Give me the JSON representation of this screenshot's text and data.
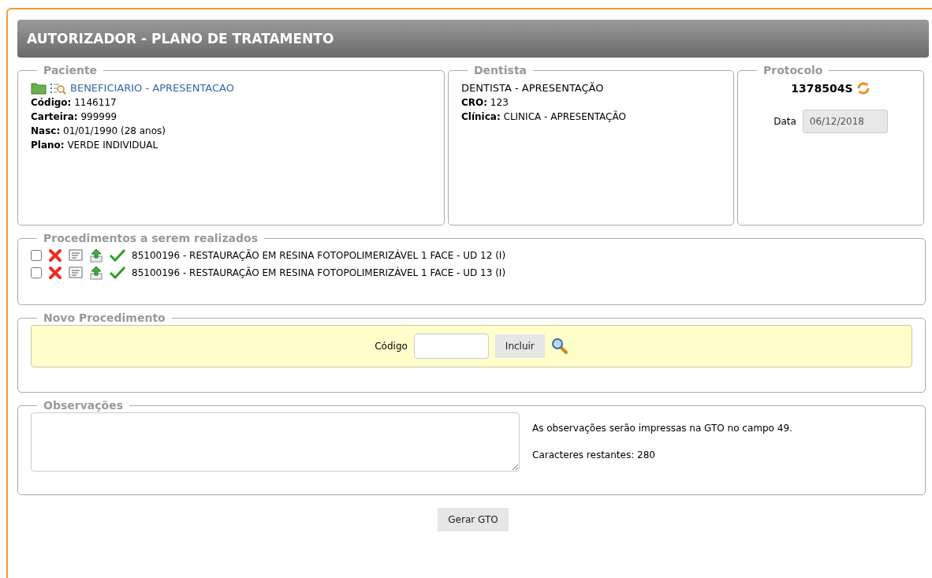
{
  "header": {
    "title": "AUTORIZADOR - PLANO DE TRATAMENTO"
  },
  "patient": {
    "legend": "Paciente",
    "name": "BENEFICIARIO - APRESENTACAO",
    "fields": [
      {
        "label": "Código:",
        "value": "1146117"
      },
      {
        "label": "Carteira:",
        "value": "999999"
      },
      {
        "label": "Nasc:",
        "value": "01/01/1990 (28 anos)"
      },
      {
        "label": "Plano:",
        "value": "VERDE INDIVIDUAL"
      }
    ]
  },
  "dentist": {
    "legend": "Dentista",
    "name": "DENTISTA - APRESENTAÇÃO",
    "fields": [
      {
        "label": "CRO:",
        "value": "123"
      },
      {
        "label": "Clínica:",
        "value": "CLINICA - APRESENTAÇÃO"
      }
    ]
  },
  "protocol": {
    "legend": "Protocolo",
    "number": "1378504S",
    "date_label": "Data",
    "date_value": "06/12/2018"
  },
  "procedures": {
    "legend": "Procedimentos a serem realizados",
    "items": [
      {
        "text": "85100196 - RESTAURAÇÃO EM RESINA FOTOPOLIMERIZÁVEL 1 FACE - UD 12 (I)",
        "checked": false
      },
      {
        "text": "85100196 - RESTAURAÇÃO EM RESINA FOTOPOLIMERIZÁVEL 1 FACE - UD 13 (I)",
        "checked": false
      }
    ]
  },
  "new_procedure": {
    "legend": "Novo Procedimento",
    "code_label": "Código",
    "button": "Incluir"
  },
  "observations": {
    "legend": "Observações",
    "note": "As observações serão impressas na GTO no campo 49.",
    "remaining": "Caracteres restantes: 280"
  },
  "submit_button": "Gerar GTO"
}
